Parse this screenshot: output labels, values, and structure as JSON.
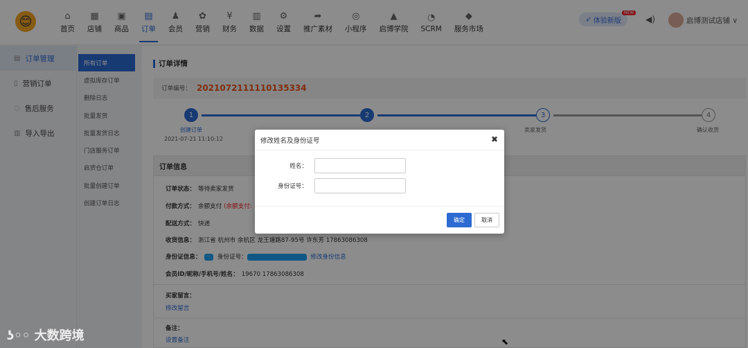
{
  "nav": [
    {
      "label": "首页",
      "icon": "home-icon",
      "glyph": "⌂"
    },
    {
      "label": "店铺",
      "icon": "shop-icon",
      "glyph": "▦"
    },
    {
      "label": "商品",
      "icon": "goods-icon",
      "glyph": "▣"
    },
    {
      "label": "订单",
      "icon": "order-icon",
      "glyph": "▤",
      "active": true
    },
    {
      "label": "会员",
      "icon": "member-icon",
      "glyph": "♟"
    },
    {
      "label": "营销",
      "icon": "marketing-icon",
      "glyph": "✿"
    },
    {
      "label": "财务",
      "icon": "finance-icon",
      "glyph": "¥"
    },
    {
      "label": "数据",
      "icon": "data-icon",
      "glyph": "▥"
    },
    {
      "label": "设置",
      "icon": "settings-icon",
      "glyph": "⚙"
    },
    {
      "label": "推广素材",
      "icon": "share-icon",
      "glyph": "➦"
    },
    {
      "label": "小程序",
      "icon": "miniapp-icon",
      "glyph": "◎"
    },
    {
      "label": "启博学院",
      "icon": "academy-icon",
      "glyph": "▲"
    },
    {
      "label": "SCRM",
      "icon": "scrm-icon",
      "glyph": "◔"
    },
    {
      "label": "服务市场",
      "icon": "market-icon",
      "glyph": "◆"
    }
  ],
  "header": {
    "trial_label": "体验新版",
    "new_badge": "NEW",
    "shop_name": "启博测试店铺 ∨"
  },
  "side1": [
    {
      "label": "订单管理",
      "active": true
    },
    {
      "label": "营销订单"
    },
    {
      "label": "售后服务"
    },
    {
      "label": "导入导出"
    }
  ],
  "side2": [
    "所有订单",
    "虚拟库存订单",
    "删除日志",
    "批量发货",
    "批量发货日志",
    "门店服务订单",
    "启货仓订单",
    "批量创建订单",
    "创建订单日志"
  ],
  "main": {
    "title": "订单详情",
    "order_no_label": "订单编号：",
    "order_no": "2021072111110135334",
    "steps": [
      {
        "num": "1",
        "label": "创建订单",
        "time": "2021-07-21 11:10:12"
      },
      {
        "num": "2",
        "label": "",
        "time": ""
      },
      {
        "num": "3",
        "label": "卖家发货",
        "time": ""
      },
      {
        "num": "4",
        "label": "确认收货",
        "time": ""
      }
    ],
    "info_title": "订单信息",
    "status_label": "订单状态：",
    "status_value": "等待卖家发货",
    "pay_label": "付款方式：",
    "pay_value": "余额支付",
    "pay_note": "(余额支付:",
    "ship_label": "配送方式：",
    "ship_value": "快递",
    "addr_label": "收货信息：",
    "addr_value": "浙江省 杭州市 余杭区 龙王塘路87-95号  许东芳   17863086308",
    "id_label": "身份证信息：",
    "id_no_label": "身份证号：",
    "id_edit": "修改身份信息",
    "member_label": "会员ID/昵称/手机号/姓名：",
    "member_value": "19670     17863086308",
    "buyer_msg_label": "买家留言：",
    "buyer_msg_edit": "修改留言",
    "remark_label": "备注：",
    "remark_edit": "设置备注"
  },
  "modal": {
    "title": "修改姓名及身份证号",
    "name_label": "姓名：",
    "id_label": "身份证号：",
    "confirm": "确定",
    "cancel": "取消"
  },
  "watermark": "大数跨境"
}
